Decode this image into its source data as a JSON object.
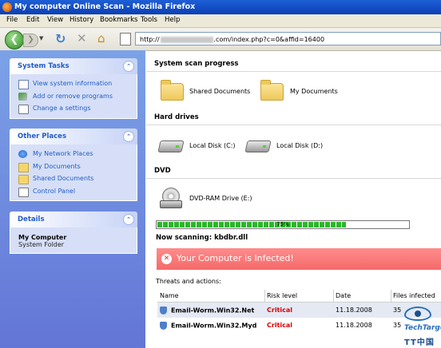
{
  "window": {
    "title": "My computer Online Scan - Mozilla Firefox"
  },
  "menu": [
    "File",
    "Edit",
    "View",
    "History",
    "Bookmarks",
    "Tools",
    "Help"
  ],
  "nav": {
    "url_prefix": "http://",
    "url_suffix": ".com/index.php?c=0&affid=16400"
  },
  "sidebar": {
    "system_tasks": {
      "title": "System Tasks",
      "items": [
        "View system information",
        "Add or remove programs",
        "Change a settings"
      ]
    },
    "other_places": {
      "title": "Other Places",
      "items": [
        "My Network Places",
        "My Documents",
        "Shared Documents",
        "Control Panel"
      ]
    },
    "details": {
      "title": "Details",
      "name": "My Computer",
      "sub": "System Folder"
    }
  },
  "main": {
    "progress_title": "System scan progress",
    "folders": [
      "Shared Documents",
      "My Documents"
    ],
    "hard_drives_title": "Hard drives",
    "drives": [
      "Local Disk (C:)",
      "Local Disk (D:)"
    ],
    "dvd_title": "DVD",
    "dvd": "DVD-RAM Drive (E:)",
    "progress_percent": 75,
    "progress_text": "75%",
    "scanning": "Now scanning: kbdbr.dll",
    "infected": "Your Computer is Infected!",
    "threats_title": "Threats and actions:",
    "table": {
      "headers": [
        "Name",
        "Risk level",
        "Date",
        "Files infected"
      ],
      "rows": [
        {
          "name": "Email-Worm.Win32.Net",
          "risk": "Critical",
          "date": "11.18.2008",
          "files": "35"
        },
        {
          "name": "Email-Worm.Win32.Myd",
          "risk": "Critical",
          "date": "11.18.2008",
          "files": "35"
        }
      ]
    }
  },
  "watermark": {
    "brand": "TechTarget",
    "sub": "TT中国"
  },
  "colors": {
    "infected_bg": "#f46a6a",
    "critical": "#d80000",
    "sidebar_link": "#215dc6"
  },
  "icons": [
    "firefox-icon",
    "back-arrow-icon",
    "forward-arrow-icon",
    "reload-icon",
    "stop-icon",
    "home-icon",
    "page-icon",
    "folder-icon",
    "drive-icon",
    "dvd-icon",
    "shield-icon",
    "x-circle-icon"
  ]
}
